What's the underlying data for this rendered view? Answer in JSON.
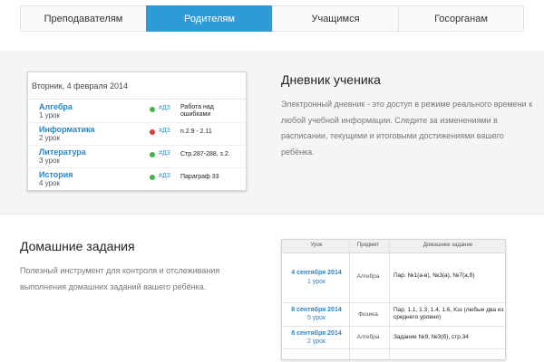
{
  "tabs": [
    {
      "label": "Преподавателям",
      "active": false
    },
    {
      "label": "Родителям",
      "active": true
    },
    {
      "label": "Учащимся",
      "active": false
    },
    {
      "label": "Госорганам",
      "active": false
    }
  ],
  "colors": {
    "accent": "#2e9ad6",
    "green_dot": "#3fb44b",
    "red_dot": "#d63b2f",
    "link": "#2a84c4"
  },
  "diary_widget": {
    "date": "Вторник, 4 февраля 2014",
    "rows": [
      {
        "subject": "Алгебра",
        "lesson": "1 урок",
        "status": "green",
        "hw_tag": "#ДЗ",
        "task": "Работа над ошибками"
      },
      {
        "subject": "Информатика",
        "lesson": "2 урок",
        "status": "red",
        "hw_tag": "#ДЗ",
        "task": "п.2.9 - 2.11"
      },
      {
        "subject": "Литература",
        "lesson": "3 урок",
        "status": "green",
        "hw_tag": "#ДЗ",
        "task": "Стр.287-288, з.2."
      },
      {
        "subject": "История",
        "lesson": "4 урок",
        "status": "green",
        "hw_tag": "#ДЗ",
        "task": "Параграф 33"
      }
    ]
  },
  "diary_section": {
    "title": "Дневник ученика",
    "text": "Электронный дневник - это доступ в режиме реального времени к любой учебной информации. Следите за изменениями в расписании, текущими и итоговыми достижениями вашего ребёнка."
  },
  "homework_section": {
    "title": "Домашние задания",
    "text": "Полезный инструмент для контроля и отслеживания выполнения домашних заданий вашего ребёнка."
  },
  "homework_table": {
    "headers": [
      "Урок",
      "Предмет",
      "Домашнее задание"
    ],
    "rows": [
      {
        "date": "4 сентября 2014",
        "lesson": "1 урок",
        "subject": "Алгебра",
        "task": "Пар. №1(а-в), №3(а), №7(а,б)"
      },
      {
        "date": "8 сентября 2014",
        "lesson": "5 урок",
        "subject": "Физика",
        "task": "Пар. 1.1, 1.3, 1.4, 1.6, Кзз (любые два из среднего уровня)"
      },
      {
        "date": "8 сентября 2014",
        "lesson": "2 урок",
        "subject": "Алгебра",
        "task": "Задание №9, №3(б), стр.34"
      }
    ]
  }
}
